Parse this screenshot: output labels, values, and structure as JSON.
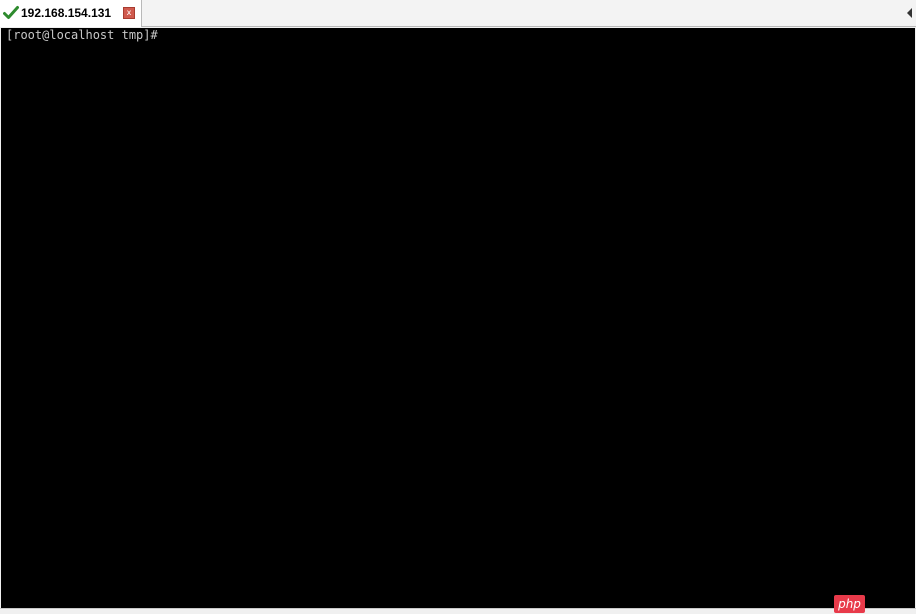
{
  "session_tab": {
    "title": "192.168.154.131",
    "status_icon": "green-checkmark-icon",
    "close_label": "x"
  },
  "terminal": {
    "prompt": "[root@localhost tmp]#"
  },
  "watermark": {
    "text": "php"
  },
  "colors": {
    "terminal_bg": "#000000",
    "terminal_fg": "#c8c8c8",
    "check_green": "#2e8b2e",
    "close_red": "#d05a4e",
    "watermark_red": "#e83a4a"
  }
}
